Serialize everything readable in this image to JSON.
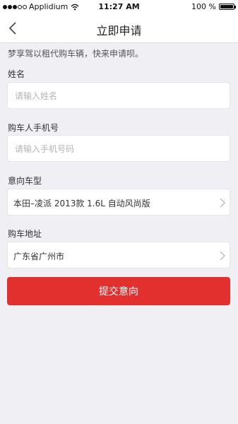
{
  "status_bar": {
    "carrier": "Applidium",
    "time": "11:27 AM",
    "battery": "100 %",
    "battery_level": 1.0
  },
  "nav": {
    "title": "立即申请",
    "back_icon": "chevron-left-icon"
  },
  "intro_text": "梦享驾以租代购车辆，快来申请呗。",
  "form": {
    "name": {
      "label": "姓名",
      "placeholder": "请输入姓名",
      "value": ""
    },
    "phone": {
      "label": "购车人手机号",
      "placeholder": "请输入手机号码",
      "value": ""
    },
    "car_model": {
      "label": "意向车型",
      "value": "本田–凌派 2013款 1.6L 自动风尚版"
    },
    "address": {
      "label": "购车地址",
      "value": "广东省广州市"
    }
  },
  "submit_label": "提交意向",
  "colors": {
    "accent": "#e2302f",
    "background": "#efeff4",
    "field_bg": "#ffffff"
  }
}
